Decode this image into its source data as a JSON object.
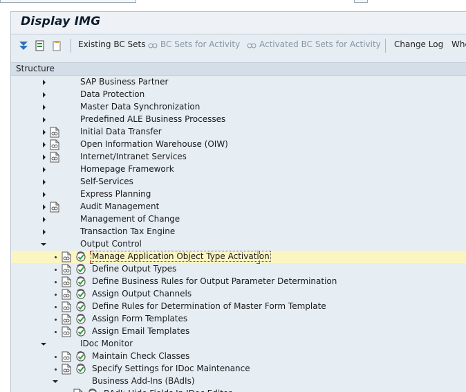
{
  "window": {
    "title": "Display IMG"
  },
  "toolbar": {
    "existing_bc_sets": "Existing BC Sets",
    "bc_sets_for_activity": "BC Sets for Activity",
    "activated_bc_sets": "Activated BC Sets for Activity",
    "change_log": "Change Log",
    "where_used_partial": "Whe"
  },
  "structure_header": "Structure",
  "tree": [
    {
      "label": "SAP Business Partner",
      "level": 1,
      "state": "collapsed",
      "doc": false,
      "exec": false
    },
    {
      "label": "Data Protection",
      "level": 1,
      "state": "collapsed",
      "doc": false,
      "exec": false
    },
    {
      "label": "Master Data Synchronization",
      "level": 1,
      "state": "collapsed",
      "doc": false,
      "exec": false
    },
    {
      "label": "Predefined ALE Business Processes",
      "level": 1,
      "state": "collapsed",
      "doc": false,
      "exec": false
    },
    {
      "label": "Initial Data Transfer",
      "level": 1,
      "state": "collapsed",
      "doc": true,
      "exec": false
    },
    {
      "label": "Open Information Warehouse (OIW)",
      "level": 1,
      "state": "collapsed",
      "doc": true,
      "exec": false
    },
    {
      "label": "Internet/Intranet Services",
      "level": 1,
      "state": "collapsed",
      "doc": true,
      "exec": false
    },
    {
      "label": "Homepage Framework",
      "level": 1,
      "state": "collapsed",
      "doc": false,
      "exec": false
    },
    {
      "label": "Self-Services",
      "level": 1,
      "state": "collapsed",
      "doc": false,
      "exec": false
    },
    {
      "label": "Express Planning",
      "level": 1,
      "state": "collapsed",
      "doc": false,
      "exec": false
    },
    {
      "label": "Audit Management",
      "level": 1,
      "state": "collapsed",
      "doc": true,
      "exec": false
    },
    {
      "label": "Management of Change",
      "level": 1,
      "state": "collapsed",
      "doc": false,
      "exec": false
    },
    {
      "label": "Transaction Tax Engine",
      "level": 1,
      "state": "collapsed",
      "doc": false,
      "exec": false
    },
    {
      "label": "Output Control",
      "level": 1,
      "state": "expanded",
      "doc": false,
      "exec": false
    },
    {
      "label": "Manage Application Object Type Activation",
      "level": 2,
      "state": "leaf",
      "doc": true,
      "exec": true,
      "selected": true
    },
    {
      "label": "Define Output Types",
      "level": 2,
      "state": "leaf",
      "doc": true,
      "exec": true
    },
    {
      "label": "Define Business Rules for Output Parameter Determination",
      "level": 2,
      "state": "leaf",
      "doc": true,
      "exec": true
    },
    {
      "label": "Assign Output Channels",
      "level": 2,
      "state": "leaf",
      "doc": true,
      "exec": true
    },
    {
      "label": "Define Rules for Determination of Master Form Template",
      "level": 2,
      "state": "leaf",
      "doc": true,
      "exec": true
    },
    {
      "label": "Assign Form Templates",
      "level": 2,
      "state": "leaf",
      "doc": true,
      "exec": true
    },
    {
      "label": "Assign Email Templates",
      "level": 2,
      "state": "leaf",
      "doc": true,
      "exec": true
    },
    {
      "label": "IDoc Monitor",
      "level": 1,
      "state": "expanded",
      "doc": false,
      "exec": false
    },
    {
      "label": "Maintain Check Classes",
      "level": 2,
      "state": "leaf",
      "doc": true,
      "exec": true
    },
    {
      "label": "Specify Settings for IDoc Maintenance",
      "level": 2,
      "state": "leaf",
      "doc": true,
      "exec": true
    },
    {
      "label": "Business Add-Ins (BAdIs)",
      "level": 2,
      "state": "expanded",
      "doc": false,
      "exec": false
    },
    {
      "label": "BAdI: Hide Fields In IDoc Editor",
      "level": 3,
      "state": "leaf",
      "doc": true,
      "exec": true
    }
  ]
}
